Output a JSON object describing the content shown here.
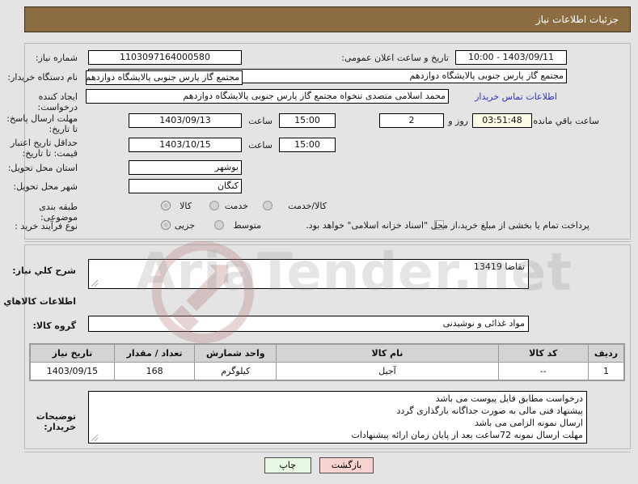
{
  "header": {
    "title": "جزئیات اطلاعات نیاز"
  },
  "watermark": {
    "text": "AriaTender.net"
  },
  "form": {
    "need_number_label": "شماره نیاز:",
    "need_number_value": "1103097164000580",
    "announce_label": "تاریخ و ساعت اعلان عمومی:",
    "announce_value": "1403/09/11 - 10:00",
    "buyer_org_label": "نام دستگاه خریدار:",
    "buyer_org_value": "مجتمع گاز پارس جنوبی  پالایشگاه دوازدهم",
    "buyer_org_overflow": "مجتمع گاز پارس جنوبی  پالایشگاه دوازدهم",
    "requester_label": "ایجاد کننده درخواست:",
    "requester_value": "محمد اسلامی متصدی تنخواه مجتمع گاز پارس جنوبی  پالایشگاه دوازدهم",
    "contact_link": "اطلاعات تماس خریدار",
    "reply_deadline_label": "مهلت ارسال پاسخ: تا تاریخ:",
    "reply_deadline_date": "1403/09/13",
    "reply_deadline_hour_label": "ساعت",
    "reply_deadline_hour": "15:00",
    "days_value": "2",
    "days_label": "روز و",
    "countdown_value": "03:51:48",
    "countdown_label": "ساعت باقي مانده",
    "price_validity_label": "حداقل تاریخ اعتبار قیمت: تا تاریخ:",
    "price_validity_date": "1403/10/15",
    "price_validity_hour_label": "ساعت",
    "price_validity_hour": "15:00",
    "province_label": "استان محل تحویل:",
    "province_value": "بوشهر",
    "city_label": "شهر محل تحویل:",
    "city_value": "کنگان",
    "category_label": "طبقه بندی موضوعی:",
    "category_options": [
      "کالا",
      "خدمت",
      "کالا/خدمت"
    ],
    "category_selected": "کالا",
    "process_label": "نوع فرآیند خرید :",
    "process_options": [
      "جزیی",
      "متوسط"
    ],
    "process_selected": "جزیی",
    "treasury_note": "پرداخت تمام یا بخشی از مبلغ خرید،از محل \"اسناد خزانه اسلامی\" خواهد بود."
  },
  "description": {
    "need_desc_label": "شرح کلي نیاز:",
    "need_desc_value": "تقاضا 13419",
    "goods_info_title": "اطلاعات کالاهاي مورد نیاز",
    "goods_group_label": "گروه کالا:",
    "goods_group_value": "مواد غذائی و نوشیدنی"
  },
  "table": {
    "headers": [
      "ردیف",
      "کد کالا",
      "نام کالا",
      "واحد شمارش",
      "تعداد / مقدار",
      "تاریخ نیاز"
    ],
    "rows": [
      {
        "row": "1",
        "code": "--",
        "name": "آجیل",
        "unit": "کیلوگرم",
        "quantity": "168",
        "need_date": "1403/09/15"
      }
    ]
  },
  "notes": {
    "label": "توضیحات خریدار:",
    "lines": [
      "درخواست مطابق فایل پیوست می باشد",
      "پیشنهاد فنی مالی به صورت جداگانه بارگذاری گردد",
      "ارسال نمونه الزامی می باشد",
      "مهلت ارسال نمونه 72ساعت بعد از پایان زمان ارائه پیشنهادات"
    ]
  },
  "buttons": {
    "print": "چاپ",
    "back": "بازگشت"
  },
  "colors": {
    "header_bg": "#8c6d42",
    "page_bg": "#e4e4e4",
    "link": "#3030c8",
    "print_btn": "#e8f6e4",
    "back_btn": "#f9d2d2",
    "countdown_bg": "#fbfbe8",
    "table_header_bg": "#d4d4d4"
  }
}
